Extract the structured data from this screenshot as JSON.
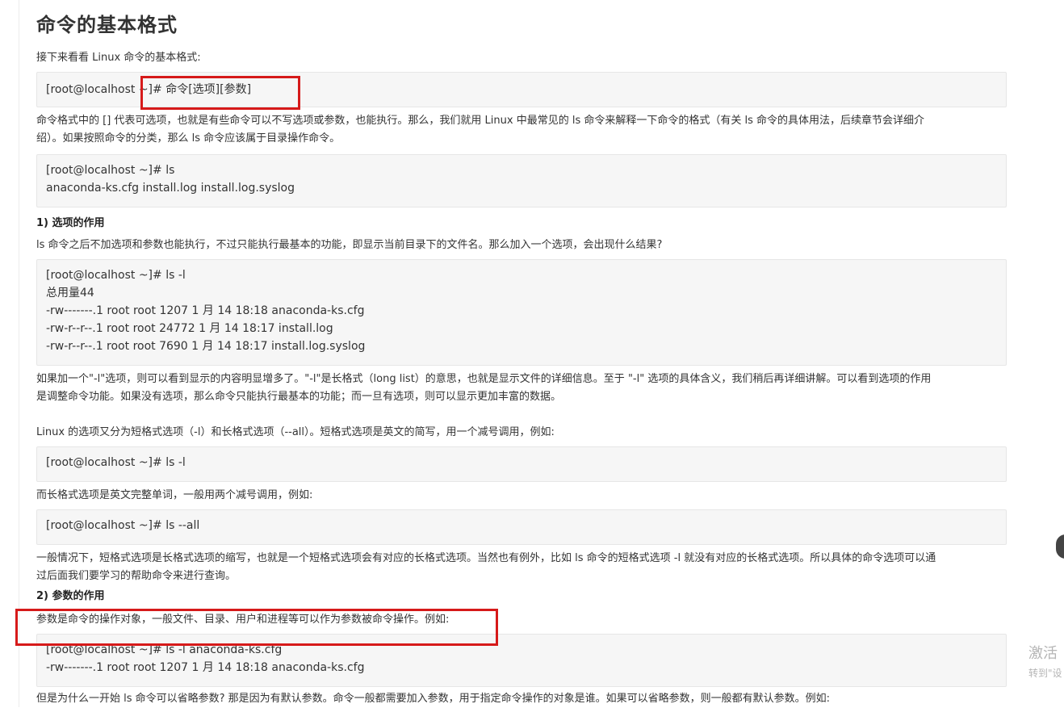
{
  "article": {
    "title": "命令的基本格式",
    "intro": "接下来看看 Linux 命令的基本格式:",
    "code_format": [
      "[root@localhost ~]# 命令[选项][参数]"
    ],
    "para_brackets_1": "命令格式中的 [] 代表可选项，也就是有些命令可以不写选项或参数，也能执行。那么，我们就用 Linux 中最常见的 ls 命令来解释一下命令的格式（有关 ls 命令的具体用法，后续章节会详细介",
    "para_brackets_2": "绍）。如果按照命令的分类，那么 ls 命令应该属于目录操作命令。",
    "code_ls": [
      "[root@localhost ~]# ls",
      "anaconda-ks.cfg install.log install.log.syslog"
    ],
    "section1_title": "1) 选项的作用",
    "section1_intro": "ls 命令之后不加选项和参数也能执行，不过只能执行最基本的功能，即显示当前目录下的文件名。那么加入一个选项，会出现什么结果?",
    "code_ls_l": [
      "[root@localhost ~]# ls -l",
      "总用量44",
      "-rw-------.1 root root 1207 1 月 14 18:18 anaconda-ks.cfg",
      "-rw-r--r--.1 root root 24772 1 月 14 18:17 install.log",
      "-rw-r--r--.1 root root 7690 1 月 14 18:17 install.log.syslog"
    ],
    "para_option_1": "如果加一个\"-l\"选项，则可以看到显示的内容明显增多了。\"-l\"是长格式（long list）的意思，也就是显示文件的详细信息。至于 \"-l\" 选项的具体含义，我们稍后再详细讲解。可以看到选项的作用",
    "para_option_2": "是调整命令功能。如果没有选项，那么命令只能执行最基本的功能；而一旦有选项，则可以显示更加丰富的数据。",
    "para_short": "Linux 的选项又分为短格式选项（-l）和长格式选项（--all）。短格式选项是英文的简写，用一个减号调用，例如:",
    "code_short": [
      "[root@localhost ~]# ls -l"
    ],
    "para_long": "而长格式选项是英文完整单词，一般用两个减号调用，例如:",
    "code_long": [
      "[root@localhost ~]# ls --all"
    ],
    "para_general_1": "一般情况下，短格式选项是长格式选项的缩写，也就是一个短格式选项会有对应的长格式选项。当然也有例外，比如 ls 命令的短格式选项 -l 就没有对应的长格式选项。所以具体的命令选项可以通",
    "para_general_2": "过后面我们要学习的帮助命令来进行查询。",
    "section2_title": "2) 参数的作用",
    "section2_intro": "参数是命令的操作对象，一般文件、目录、用户和进程等可以作为参数被命令操作。例如:",
    "code_arg": [
      "[root@localhost ~]# ls -l anaconda-ks.cfg",
      "-rw-------.1 root root 1207 1 月 14 18:18 anaconda-ks.cfg"
    ],
    "para_cut": "但是为什么一开始 ls 命令可以省略参数? 那是因为有默认参数。命令一般都需要加入参数，用于指定命令操作的对象是谁。如果可以省略参数，则一般都有默认参数。例如:"
  },
  "watermark": {
    "main": "激活",
    "sub": "转到\"设"
  },
  "colors": {
    "highlight": "#d61a1a",
    "code_bg": "#f6f6f6"
  }
}
